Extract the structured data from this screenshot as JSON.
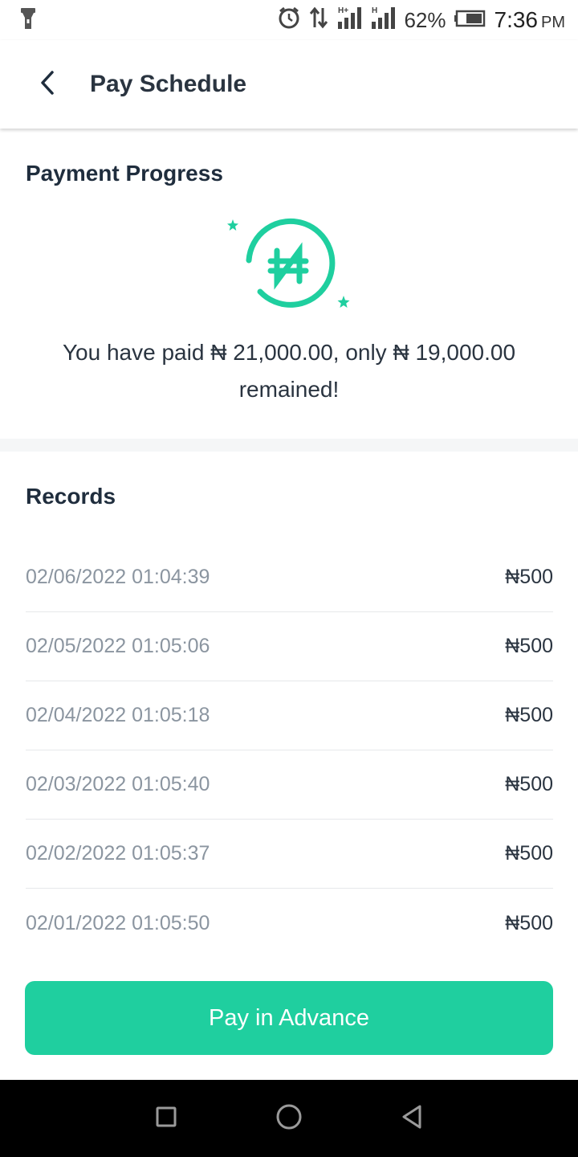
{
  "status_bar": {
    "battery": "62%",
    "time": "7:36",
    "ampm": "PM",
    "icons": [
      "flashlight-icon",
      "alarm-icon",
      "data-transfer-icon",
      "signal-h-plus-icon",
      "signal-h-icon",
      "battery-icon"
    ]
  },
  "header": {
    "title": "Pay Schedule",
    "back_icon": "chevron-left-icon"
  },
  "progress": {
    "title": "Payment Progress",
    "icon": "naira-coin-icon",
    "message": "You have paid ₦ 21,000.00, only ₦ 19,000.00 remained!"
  },
  "records": {
    "title": "Records",
    "items": [
      {
        "date": "02/06/2022 01:04:39",
        "amount": "₦500"
      },
      {
        "date": "02/05/2022 01:05:06",
        "amount": "₦500"
      },
      {
        "date": "02/04/2022 01:05:18",
        "amount": "₦500"
      },
      {
        "date": "02/03/2022 01:05:40",
        "amount": "₦500"
      },
      {
        "date": "02/02/2022 01:05:37",
        "amount": "₦500"
      },
      {
        "date": "02/01/2022 01:05:50",
        "amount": "₦500"
      }
    ]
  },
  "actions": {
    "pay_label": "Pay in Advance"
  },
  "colors": {
    "accent": "#1fcf9f",
    "title_text": "#1f2d3d",
    "muted_text": "#8b95a0",
    "nav_bar": "#000000"
  },
  "nav": {
    "icons": [
      "recent-apps-icon",
      "home-icon",
      "back-icon"
    ]
  }
}
